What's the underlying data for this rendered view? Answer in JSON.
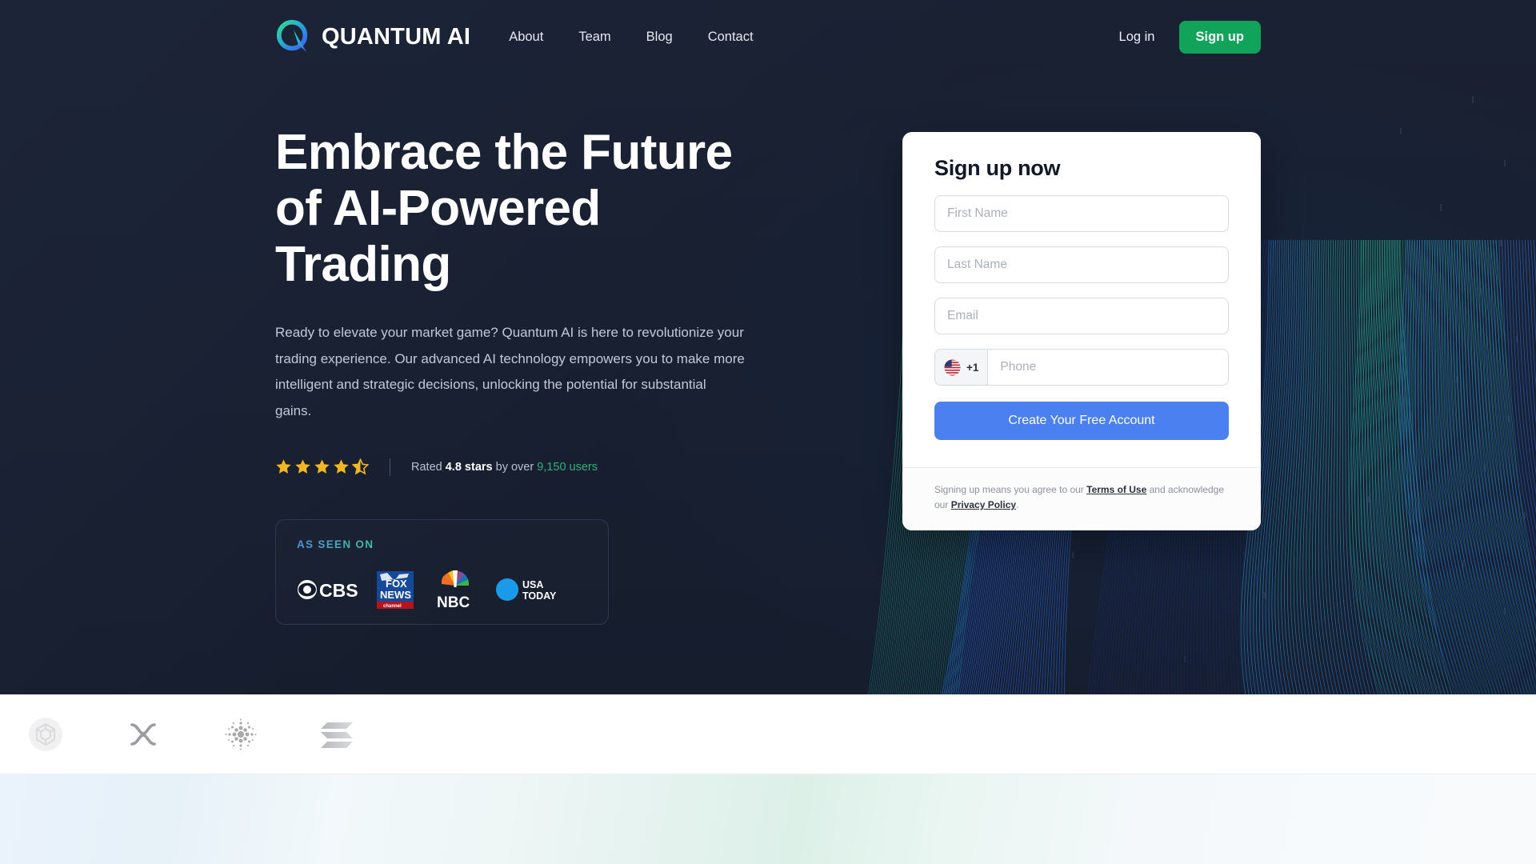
{
  "brand": {
    "name": "QUANTUM AI",
    "logo_icon": "quantum-q-logo-icon"
  },
  "nav": {
    "links": [
      {
        "label": "About"
      },
      {
        "label": "Team"
      },
      {
        "label": "Blog"
      },
      {
        "label": "Contact"
      }
    ],
    "login_label": "Log in",
    "signup_label": "Sign up",
    "signup_color": "#12a35b"
  },
  "hero": {
    "headline": "Embrace the Future of AI-Powered Trading",
    "subcopy": "Ready to elevate your market game? Quantum AI is here to revolutionize your trading experience. Our advanced AI technology empowers you to make more intelligent and strategic decisions, unlocking the potential for substantial gains.",
    "rating": {
      "stars_filled": 4,
      "stars_half": 1,
      "stars_total": 5,
      "score": "4.8",
      "prefix": "Rated ",
      "score_suffix": " stars",
      "middle": " by over ",
      "users": "9,150 users",
      "users_color": "#2fb37a",
      "star_color": "#f2b824"
    },
    "as_seen_on": {
      "label": "AS SEEN ON",
      "label_gradient_from": "#4d93d8",
      "label_gradient_to": "#3fbfa0",
      "logos": [
        {
          "name": "cbs-logo",
          "text": "CBS"
        },
        {
          "name": "fox-news-logo",
          "text": "FOX NEWS",
          "sub": "channel"
        },
        {
          "name": "nbc-logo",
          "text": "NBC"
        },
        {
          "name": "usa-today-logo",
          "text": "USA TODAY"
        }
      ]
    }
  },
  "signup_card": {
    "title": "Sign up now",
    "first_name_placeholder": "First Name",
    "first_name_value": "",
    "last_name_placeholder": "Last Name",
    "last_name_value": "",
    "email_placeholder": "Email",
    "email_value": "",
    "country_code": "+1",
    "country_flag": "us-flag-icon",
    "phone_placeholder": "Phone",
    "phone_value": "",
    "cta_label": "Create Your Free Account",
    "cta_color": "#4a80f0",
    "legal_prefix": "Signing up means you agree to our ",
    "legal_terms": "Terms of Use",
    "legal_middle": " and acknowledge our ",
    "legal_privacy": "Privacy Policy",
    "legal_suffix": "."
  },
  "crypto_strip": {
    "items": [
      {
        "name": "bnb-coin-icon"
      },
      {
        "name": "xrp-coin-icon"
      },
      {
        "name": "cardano-coin-icon"
      },
      {
        "name": "solana-coin-icon"
      }
    ]
  }
}
